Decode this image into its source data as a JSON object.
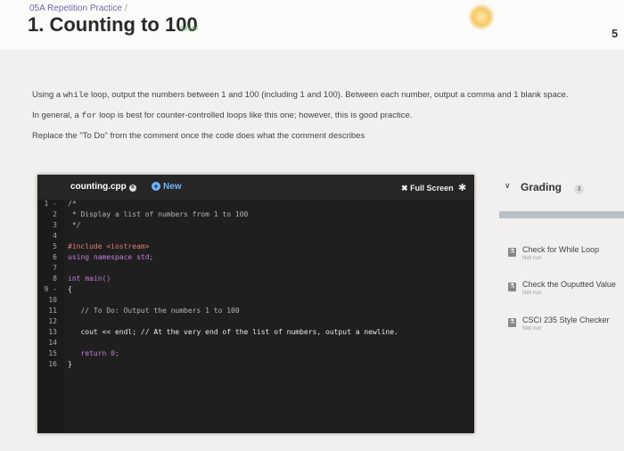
{
  "header": {
    "breadcrumb": "05A Repetition Practice",
    "breadcrumb_sep": "/",
    "title": "1. Counting to 100",
    "saved": "Saved",
    "page_number": "5"
  },
  "instructions": {
    "p1_a": "Using a ",
    "p1_code1": "while",
    "p1_b": " loop, output the numbers between 1 and 100 (including 1 and 100). Between each number, output a comma and 1 blank space.",
    "p2_a": "In general, a ",
    "p2_code1": "for",
    "p2_b": " loop is best for counter-controlled loops like this one; however, this is good practice.",
    "p3": "Replace the \"To Do\" from the comment once the code does what the comment describes"
  },
  "editor": {
    "filename": "counting.cpp",
    "close_glyph": "×",
    "new_label": "New",
    "new_glyph": "+",
    "fullscreen_label": "Full Screen",
    "fullscreen_glyph": "✖",
    "gear_glyph": "✱",
    "lines": [
      {
        "n": "1 -",
        "t": "/*"
      },
      {
        "n": "2",
        "t": " * Display a list of numbers from 1 to 100"
      },
      {
        "n": "3",
        "t": " */"
      },
      {
        "n": "4",
        "t": ""
      },
      {
        "n": "5",
        "t": "#include <iostream>"
      },
      {
        "n": "6",
        "t": "using namespace std;"
      },
      {
        "n": "7",
        "t": ""
      },
      {
        "n": "8",
        "t": "int main()"
      },
      {
        "n": "9 -",
        "t": "{"
      },
      {
        "n": "10",
        "t": ""
      },
      {
        "n": "11",
        "t": "   // To Do: Output the numbers 1 to 100"
      },
      {
        "n": "12",
        "t": ""
      },
      {
        "n": "13",
        "t": "   cout << endl; // At the very end of the list of numbers, output a newline."
      },
      {
        "n": "14",
        "t": ""
      },
      {
        "n": "15",
        "t": "   return 0;"
      },
      {
        "n": "16",
        "t": "}"
      }
    ]
  },
  "sidebar": {
    "grading_label": "Grading",
    "grading_count": "3",
    "chevron_glyph": "∨",
    "progress_fraction": 1,
    "items": [
      {
        "title": "Check for While Loop",
        "status": "Not run",
        "icon": "⚗"
      },
      {
        "title": "Check the Ouputted Value",
        "status": "Not run",
        "icon": "⚗"
      },
      {
        "title": "CSCI 235 Style Checker",
        "status": "Not run",
        "icon": "⚗"
      }
    ]
  },
  "colors": {
    "editor_bg": "#1f1f1f",
    "keyword": "#c27fd8",
    "preprocessor": "#e77a7a",
    "string_include": "#e0c070",
    "comment": "#b5b5b5",
    "accent_blue": "#6fb4ff"
  }
}
